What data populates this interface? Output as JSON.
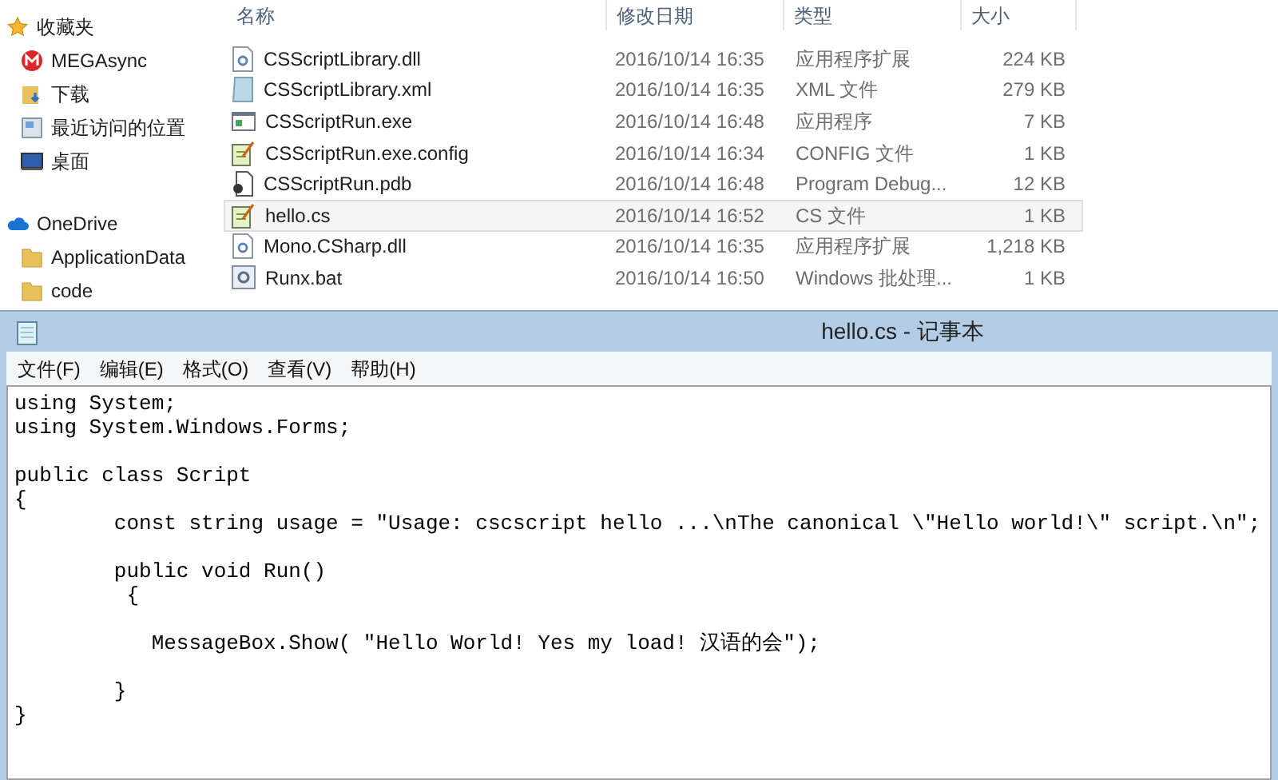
{
  "sidebar": {
    "groups": [
      {
        "label": "收藏夹",
        "kind": "star",
        "items": [
          {
            "label": "MEGAsync",
            "kind": "mega"
          },
          {
            "label": "下载",
            "kind": "download"
          },
          {
            "label": "最近访问的位置",
            "kind": "recent"
          },
          {
            "label": "桌面",
            "kind": "desktop"
          }
        ]
      },
      {
        "label": "OneDrive",
        "kind": "cloud",
        "items": [
          {
            "label": "ApplicationData",
            "kind": "folder"
          },
          {
            "label": "code",
            "kind": "folder"
          }
        ]
      }
    ]
  },
  "file_list": {
    "columns": [
      "名称",
      "修改日期",
      "类型",
      "大小"
    ],
    "rows": [
      {
        "name": "CSScriptLibrary.dll",
        "date": "2016/10/14 16:35",
        "type": "应用程序扩展",
        "size": "224 KB",
        "kind": "dll",
        "selected": false
      },
      {
        "name": "CSScriptLibrary.xml",
        "date": "2016/10/14 16:35",
        "type": "XML 文件",
        "size": "279 KB",
        "kind": "xml",
        "selected": false
      },
      {
        "name": "CSScriptRun.exe",
        "date": "2016/10/14 16:48",
        "type": "应用程序",
        "size": "7 KB",
        "kind": "exe",
        "selected": false
      },
      {
        "name": "CSScriptRun.exe.config",
        "date": "2016/10/14 16:34",
        "type": "CONFIG 文件",
        "size": "1 KB",
        "kind": "text",
        "selected": false
      },
      {
        "name": "CSScriptRun.pdb",
        "date": "2016/10/14 16:48",
        "type": "Program Debug...",
        "size": "12 KB",
        "kind": "pdb",
        "selected": false
      },
      {
        "name": "hello.cs",
        "date": "2016/10/14 16:52",
        "type": "CS 文件",
        "size": "1 KB",
        "kind": "text",
        "selected": true
      },
      {
        "name": "Mono.CSharp.dll",
        "date": "2016/10/14 16:35",
        "type": "应用程序扩展",
        "size": "1,218 KB",
        "kind": "dll",
        "selected": false
      },
      {
        "name": "Runx.bat",
        "date": "2016/10/14 16:50",
        "type": "Windows 批处理...",
        "size": "1 KB",
        "kind": "bat",
        "selected": false
      }
    ]
  },
  "notepad": {
    "title": "hello.cs - 记事本",
    "menu": [
      "文件(F)",
      "编辑(E)",
      "格式(O)",
      "查看(V)",
      "帮助(H)"
    ],
    "paragraphs": [
      [
        "using System;",
        "using System.Windows.Forms;"
      ],
      [
        "public class Script",
        "{",
        "        const string usage = \"Usage: cscscript hello ...\\nThe canonical \\\"Hello world!\\\" script.\\n\";"
      ],
      [
        "        public void Run()",
        "         {"
      ],
      [
        "           MessageBox.Show( \"Hello World! Yes my load! 汉语的会\");"
      ],
      [
        "        }",
        "}"
      ]
    ]
  }
}
